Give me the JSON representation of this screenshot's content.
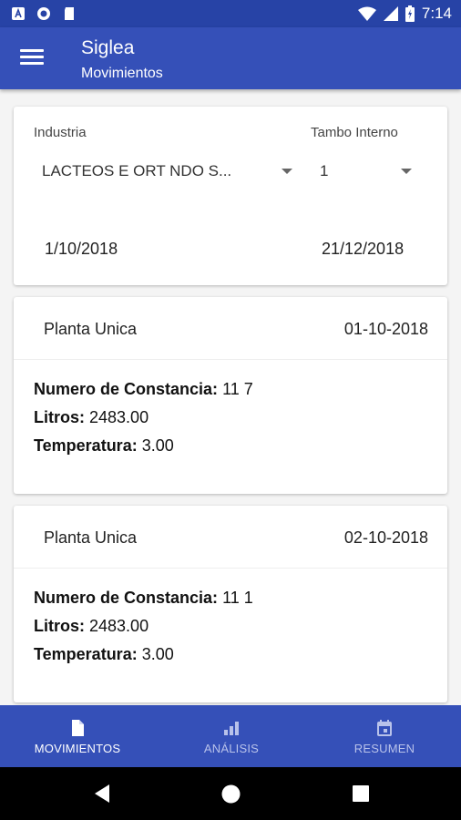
{
  "status_bar": {
    "time": "7:14",
    "icons": [
      "notification-a-icon",
      "sync-icon",
      "sd-card-icon",
      "wifi-icon",
      "signal-icon",
      "battery-icon"
    ]
  },
  "app_bar": {
    "title": "Siglea",
    "subtitle": "Movimientos",
    "menu_icon": "menu-icon"
  },
  "filters": {
    "industria_label": "Industria",
    "industria_value": "LACTEOS E  ORT   NDO S...",
    "tambo_label": "Tambo Interno",
    "tambo_value": "1",
    "fecha_desde": "1/10/2018",
    "fecha_hasta": "21/12/2018"
  },
  "movimientos": [
    {
      "planta": "Planta Unica",
      "fecha": "01-10-2018",
      "constancia_label": "Numero de Constancia:",
      "constancia_value": "11  7",
      "litros_label": "Litros:",
      "litros_value": "2483.00",
      "temperatura_label": "Temperatura:",
      "temperatura_value": "3.00"
    },
    {
      "planta": "Planta Unica",
      "fecha": "02-10-2018",
      "constancia_label": "Numero de Constancia:",
      "constancia_value": "11   1",
      "litros_label": "Litros:",
      "litros_value": "2483.00",
      "temperatura_label": "Temperatura:",
      "temperatura_value": "3.00"
    }
  ],
  "bottom_nav": [
    {
      "label": "MOVIMIENTOS",
      "icon": "document-icon",
      "active": true
    },
    {
      "label": "ANÁLISIS",
      "icon": "bar-chart-icon",
      "active": false
    },
    {
      "label": "RESUMEN",
      "icon": "calendar-icon",
      "active": false
    }
  ],
  "colors": {
    "status_bar": "#2743a6",
    "app_bar": "#3550b8",
    "nav_active": "#ffffff",
    "nav_inactive": "#b8c2ea"
  }
}
